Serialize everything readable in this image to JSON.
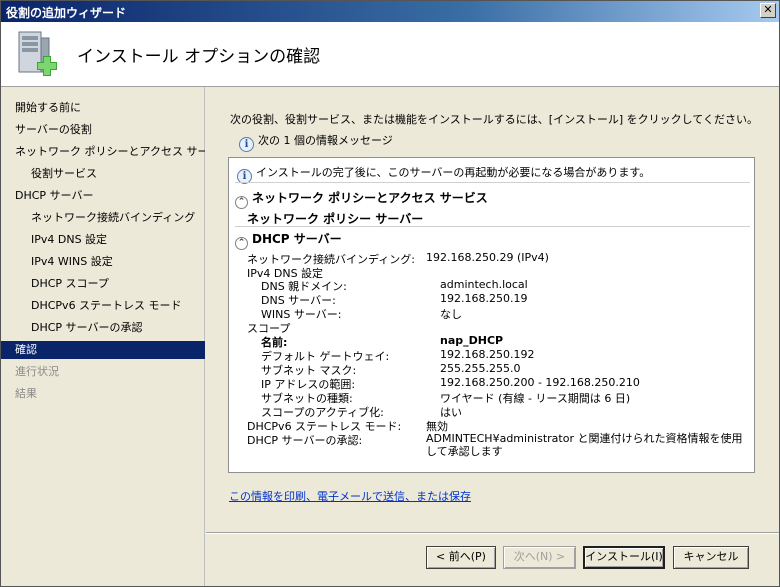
{
  "window": {
    "title": "役割の追加ウィザード"
  },
  "header": {
    "title": "インストール オプションの確認"
  },
  "nav": {
    "items": [
      {
        "label": "開始する前に",
        "level": 0,
        "state": "normal"
      },
      {
        "label": "サーバーの役割",
        "level": 0,
        "state": "normal"
      },
      {
        "label": "ネットワーク ポリシーとアクセス サービ...",
        "level": 0,
        "state": "normal"
      },
      {
        "label": "役割サービス",
        "level": 1,
        "state": "normal"
      },
      {
        "label": "DHCP サーバー",
        "level": 0,
        "state": "normal"
      },
      {
        "label": "ネットワーク接続バインディング",
        "level": 1,
        "state": "normal"
      },
      {
        "label": "IPv4 DNS 設定",
        "level": 1,
        "state": "normal"
      },
      {
        "label": "IPv4 WINS 設定",
        "level": 1,
        "state": "normal"
      },
      {
        "label": "DHCP スコープ",
        "level": 1,
        "state": "normal"
      },
      {
        "label": "DHCPv6 ステートレス モード",
        "level": 1,
        "state": "normal"
      },
      {
        "label": "DHCP サーバーの承認",
        "level": 1,
        "state": "normal"
      },
      {
        "label": "確認",
        "level": 0,
        "state": "active"
      },
      {
        "label": "進行状況",
        "level": 0,
        "state": "disabled"
      },
      {
        "label": "結果",
        "level": 0,
        "state": "disabled"
      }
    ]
  },
  "main": {
    "intro": "次の役割、役割サービス、または機能をインストールするには、[インストール] をクリックしてください。",
    "info_count": "次の 1 個の情報メッセージ",
    "panel": {
      "restart_msg": "インストールの完了後に、このサーバーの再起動が必要になる場合があります。",
      "section1_title": "ネットワーク ポリシーとアクセス サービス",
      "section1_item": "ネットワーク ポリシー サーバー",
      "section2_title": "DHCP サーバー",
      "rows": [
        {
          "label": "ネットワーク接続バインディング:",
          "value": "192.168.250.29 (IPv4)",
          "indent": 0
        },
        {
          "label": "IPv4 DNS 設定",
          "value": "",
          "indent": 0
        },
        {
          "label": "DNS 親ドメイン:",
          "value": "admintech.local",
          "indent": 1
        },
        {
          "label": "DNS サーバー:",
          "value": "192.168.250.19",
          "indent": 1
        },
        {
          "label": "WINS サーバー:",
          "value": "なし",
          "indent": 1
        },
        {
          "label": "スコープ",
          "value": "",
          "indent": 0
        },
        {
          "label": "名前:",
          "value": "nap_DHCP",
          "indent": 1,
          "bold": true
        },
        {
          "label": "デフォルト ゲートウェイ:",
          "value": "192.168.250.192",
          "indent": 1
        },
        {
          "label": "サブネット マスク:",
          "value": "255.255.255.0",
          "indent": 1
        },
        {
          "label": "IP アドレスの範囲:",
          "value": "192.168.250.200 - 192.168.250.210",
          "indent": 1
        },
        {
          "label": "サブネットの種類:",
          "value": "ワイヤード (有線 - リース期間は 6 日)",
          "indent": 1
        },
        {
          "label": "スコープのアクティブ化:",
          "value": "はい",
          "indent": 1
        },
        {
          "label": "DHCPv6 ステートレス モード:",
          "value": "無効",
          "indent": 0
        },
        {
          "label": "DHCP サーバーの承認:",
          "value": "ADMINTECH¥administrator と関連付けられた資格情報を使用して承認します",
          "indent": 0
        }
      ]
    },
    "print_link": "この情報を印刷、電子メールで送信、または保存"
  },
  "buttons": {
    "back": "< 前へ(P)",
    "next": "次へ(N) >",
    "install": "インストール(I)",
    "cancel": "キャンセル"
  }
}
